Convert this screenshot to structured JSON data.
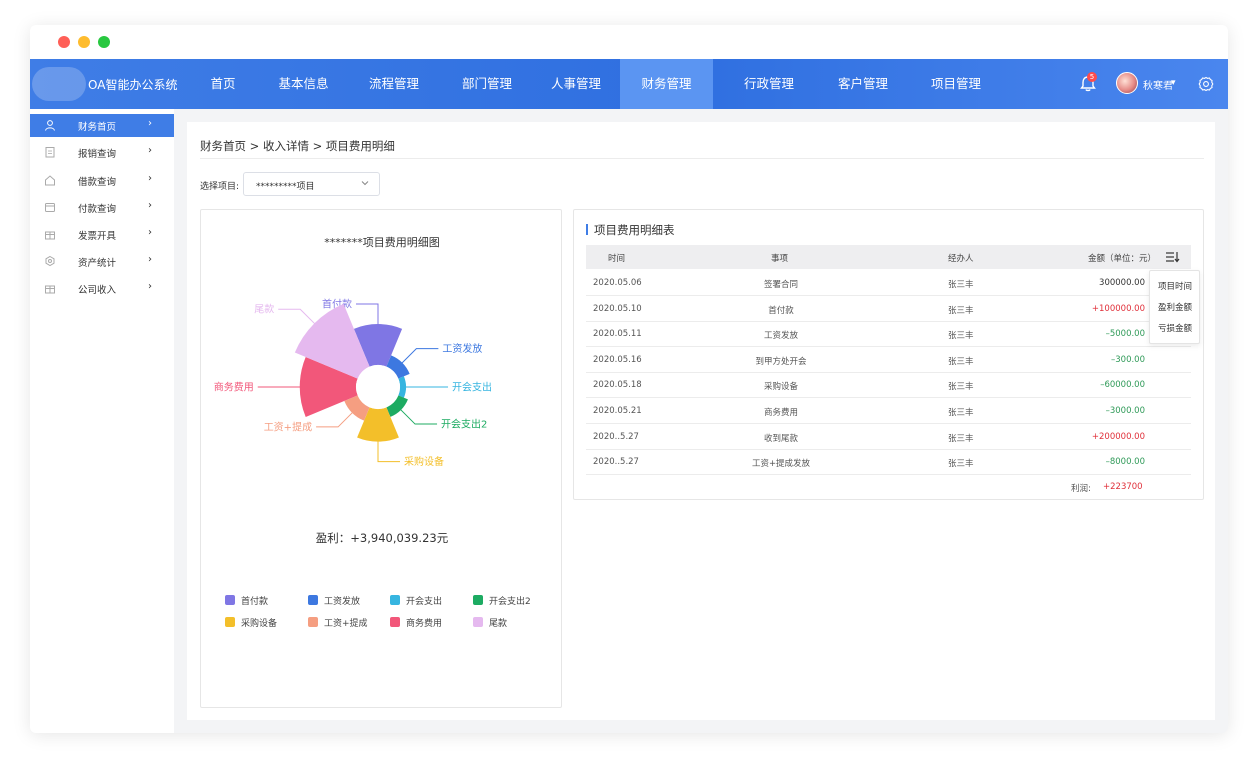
{
  "window_dots": [
    "#ff5f57",
    "#febc2e",
    "#28c840"
  ],
  "brand": {
    "title": "OA智能办公系统"
  },
  "nav": {
    "items": [
      {
        "label": "首页"
      },
      {
        "label": "基本信息"
      },
      {
        "label": "流程管理"
      },
      {
        "label": "部门管理"
      },
      {
        "label": "人事管理"
      },
      {
        "label": "财务管理",
        "active": true
      },
      {
        "label": "行政管理"
      },
      {
        "label": "客户管理"
      },
      {
        "label": "项目管理"
      }
    ],
    "bell_count": "5",
    "user_name": "秋寒君",
    "caret": "▾",
    "icons": {
      "bell": "bell-icon",
      "settings": "gear-icon",
      "user": "avatar"
    }
  },
  "sidebar": {
    "arrow": "›",
    "items": [
      {
        "label": "财务首页",
        "icon": "user-icon",
        "active": true
      },
      {
        "label": "报销查询",
        "icon": "document-icon"
      },
      {
        "label": "借款查询",
        "icon": "home-icon"
      },
      {
        "label": "付款查询",
        "icon": "card-icon"
      },
      {
        "label": "发票开具",
        "icon": "gift-icon"
      },
      {
        "label": "资产统计",
        "icon": "gear-icon"
      },
      {
        "label": "公司收入",
        "icon": "gift-icon"
      }
    ]
  },
  "page": {
    "breadcrumb": "财务首页 > 收入详情 > 项目费用明细",
    "select_label": "选择项目:",
    "select_value": "*********项目"
  },
  "chart_card": {
    "title": "*******项目费用明细图",
    "profit": "盈利：+3,940,039.23元"
  },
  "chart_data": {
    "type": "pie",
    "subtype": "rose",
    "title": "*******项目费用明细图",
    "series": [
      {
        "name": "首付款",
        "value": 100000,
        "color": "#7f76e4"
      },
      {
        "name": "工资发放",
        "value": 5000,
        "color": "#3d78e0"
      },
      {
        "name": "开会支出",
        "value": 300,
        "color": "#36b5e0"
      },
      {
        "name": "开会支出2",
        "value": 3000,
        "color": "#1dab62"
      },
      {
        "name": "采购设备",
        "value": 60000,
        "color": "#f3bf2a"
      },
      {
        "name": "工资+提成",
        "value": 8000,
        "color": "#f59e81"
      },
      {
        "name": "商务费用",
        "value": 200000,
        "color": "#f2577a"
      },
      {
        "name": "尾款",
        "value": 300000,
        "color": "#e5b9ef"
      }
    ],
    "legend_position": "bottom"
  },
  "table": {
    "title": "项目费用明细表",
    "columns": [
      "时间",
      "事项",
      "经办人",
      "金额（单位：元）"
    ],
    "rows": [
      {
        "date": "2020.05.06",
        "item": "签署合同",
        "person": "张三丰",
        "amount": "300000.00",
        "color": "#333333"
      },
      {
        "date": "2020.05.10",
        "item": "首付款",
        "person": "张三丰",
        "amount": "+100000.00",
        "color": "#e0303a"
      },
      {
        "date": "2020.05.11",
        "item": "工资发放",
        "person": "张三丰",
        "amount": "–5000.00",
        "color": "#2f9a58"
      },
      {
        "date": "2020.05.16",
        "item": "到甲方处开会",
        "person": "张三丰",
        "amount": "–300.00",
        "color": "#2f9a58"
      },
      {
        "date": "2020.05.18",
        "item": "采购设备",
        "person": "张三丰",
        "amount": "–60000.00",
        "color": "#2f9a58"
      },
      {
        "date": "2020.05.21",
        "item": "商务费用",
        "person": "张三丰",
        "amount": "–3000.00",
        "color": "#2f9a58"
      },
      {
        "date": "2020..5.27",
        "item": "收到尾款",
        "person": "张三丰",
        "amount": "+200000.00",
        "color": "#e0303a"
      },
      {
        "date": "2020..5.27",
        "item": "工资+提成发放",
        "person": "张三丰",
        "amount": "–8000.00",
        "color": "#2f9a58"
      }
    ],
    "sort_menu": [
      "项目时间",
      "盈利金额",
      "亏损金额"
    ],
    "total_label": "利润:",
    "total_value": "+223700",
    "total_color": "#e0303a"
  }
}
